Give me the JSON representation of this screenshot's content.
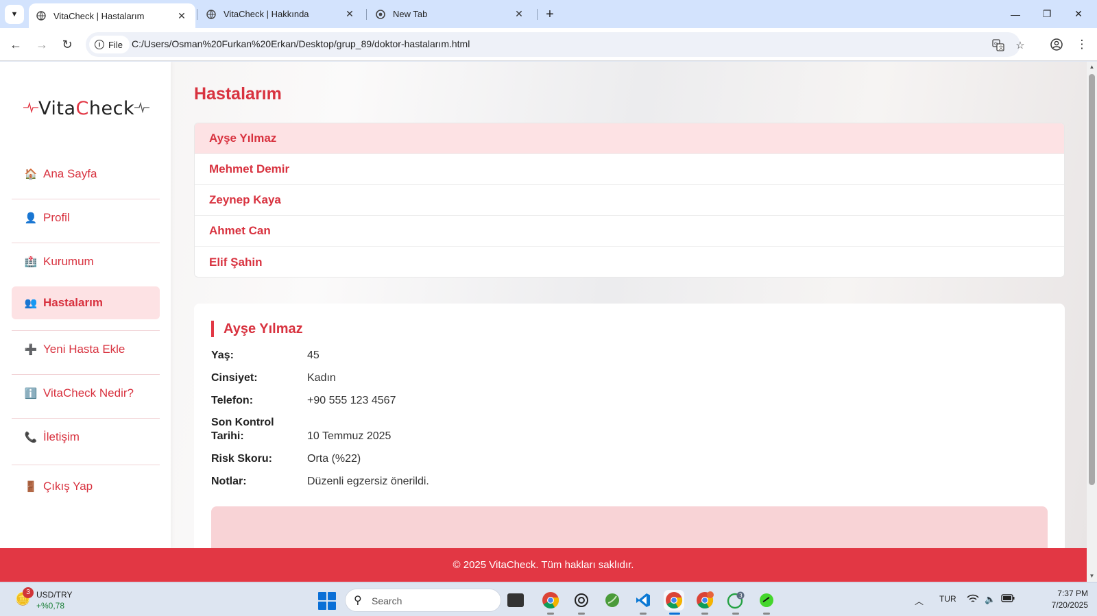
{
  "browser": {
    "tabs": [
      {
        "title": "VitaCheck | Hastalarım",
        "active": true
      },
      {
        "title": "VitaCheck | Hakkında",
        "active": false
      },
      {
        "title": "New Tab",
        "active": false
      }
    ],
    "file_label": "File",
    "url": "C:/Users/Osman%20Furkan%20Erkan/Desktop/grup_89/doktor-hastalarım.html"
  },
  "logo": {
    "prefix": "Vita",
    "highlight": "C",
    "suffix": "heck"
  },
  "sidebar": {
    "items": [
      {
        "icon": "🏠",
        "label": "Ana Sayfa"
      },
      {
        "icon": "👤",
        "label": "Profil"
      },
      {
        "icon": "🏥",
        "label": "Kurumum"
      },
      {
        "icon": "👥",
        "label": "Hastalarım"
      },
      {
        "icon": "➕",
        "label": "Yeni Hasta Ekle"
      },
      {
        "icon": "ℹ️",
        "label": "VitaCheck Nedir?"
      },
      {
        "icon": "📞",
        "label": "İletişim"
      },
      {
        "icon": "🚪",
        "label": "Çıkış Yap"
      }
    ],
    "active_index": 3
  },
  "main": {
    "title": "Hastalarım",
    "patients": [
      "Ayşe Yılmaz",
      "Mehmet Demir",
      "Zeynep Kaya",
      "Ahmet Can",
      "Elif Şahin"
    ],
    "selected_index": 0,
    "detail": {
      "name": "Ayşe Yılmaz",
      "rows": [
        {
          "label": "Yaş:",
          "value": "45"
        },
        {
          "label": "Cinsiyet:",
          "value": "Kadın"
        },
        {
          "label": "Telefon:",
          "value": "+90 555 123 4567"
        },
        {
          "label": "Son Kontrol Tarihi:",
          "value": "10 Temmuz 2025"
        },
        {
          "label": "Risk Skoru:",
          "value": "Orta (%22)"
        },
        {
          "label": "Notlar:",
          "value": "Düzenli egzersiz önerildi."
        }
      ]
    }
  },
  "footer": {
    "text": "© 2025 VitaCheck. Tüm hakları saklıdır."
  },
  "taskbar": {
    "widget": {
      "badge": "3",
      "title": "USD/TRY",
      "value": "+%0,78"
    },
    "search_placeholder": "Search",
    "tray": {
      "lang": "TUR"
    },
    "clock": {
      "time": "7:37 PM",
      "date": "7/20/2025"
    },
    "whatsapp_badge": "3"
  },
  "colors": {
    "accent": "#e23744",
    "accent_light": "#fde2e4"
  }
}
